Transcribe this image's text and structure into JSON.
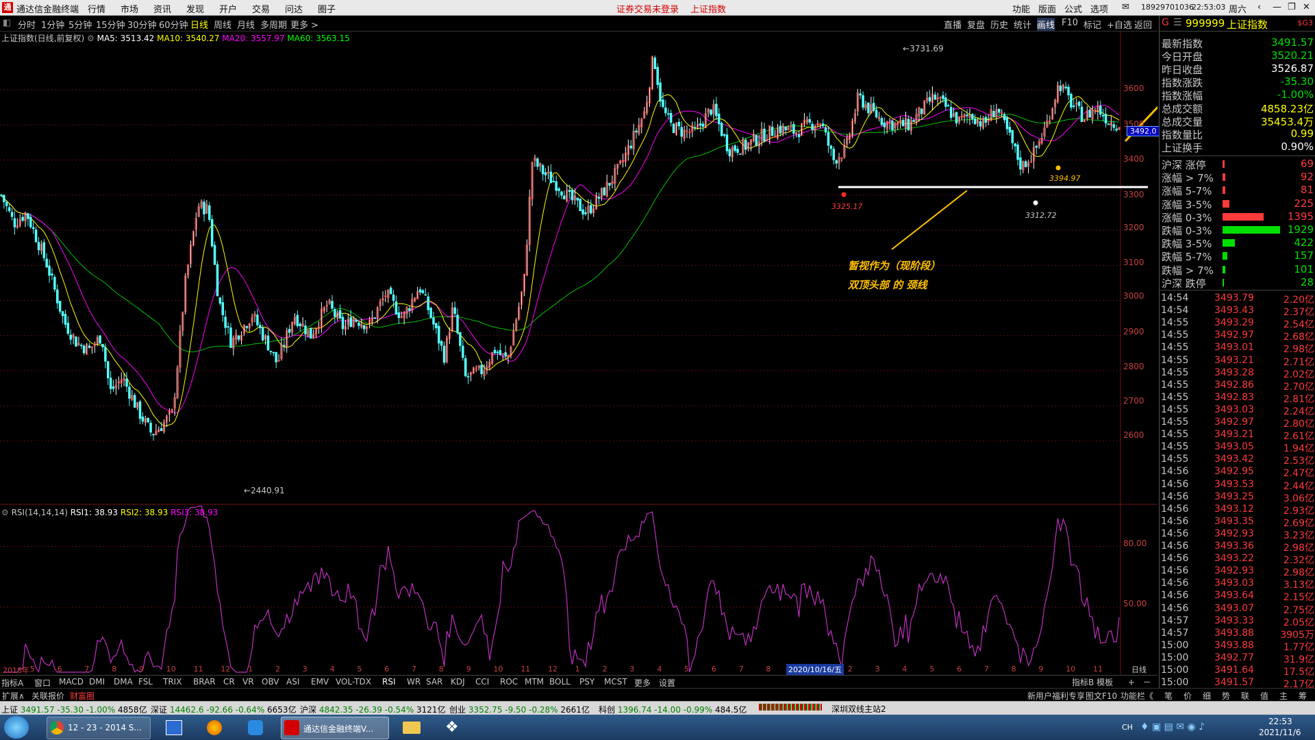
{
  "menubar": {
    "app_title": "通达信金融终端",
    "items": [
      "行情",
      "市场",
      "资讯",
      "发现",
      "开户",
      "交易",
      "问达",
      "圈子"
    ],
    "alert": "证券交易未登录",
    "alert_index": "上证指数",
    "right_items": [
      "功能",
      "版面",
      "公式",
      "选项"
    ],
    "account": "18929701036",
    "time": "22:53:03",
    "weekday": "周六"
  },
  "periodbar": {
    "periods": [
      "分时",
      "1分钟",
      "5分钟",
      "15分钟",
      "30分钟",
      "60分钟",
      "日线",
      "周线",
      "月线",
      "多周期",
      "更多 >"
    ],
    "selected": "日线",
    "tools": [
      "直播",
      "复盘",
      "历史",
      "统计",
      "画线",
      "F10",
      "标记",
      "+自选",
      "返回"
    ],
    "tool_selected": "画线"
  },
  "chart": {
    "title": "上证指数(日线,前复权)",
    "ma": [
      {
        "label": "MA5: 3513.42",
        "color": "#ffffff"
      },
      {
        "label": "MA10: 3540.27",
        "color": "#ffff00"
      },
      {
        "label": "MA20: 3557.97",
        "color": "#ff00ff"
      },
      {
        "label": "MA60: 3563.15",
        "color": "#00ff00"
      }
    ],
    "y_ticks": [
      "3600",
      "3500",
      "3400",
      "3300",
      "3200",
      "3100",
      "3000",
      "2900",
      "2800",
      "2700",
      "2600"
    ],
    "current_price_label": "3492.0",
    "annotations": {
      "high": "3731.69",
      "low": "2440.91",
      "point_a": "3325.17",
      "point_b": "3312.72",
      "point_c": "3394.97",
      "note_line1": "暂视作为（现阶段）",
      "note_line2": "双顶头部 的 颈线",
      "question": "?"
    },
    "x_ticks": [
      "2018年",
      "5",
      "6",
      "7",
      "8",
      "9",
      "10",
      "11",
      "12",
      "1",
      "2",
      "3",
      "4",
      "5",
      "6",
      "7",
      "8",
      "9",
      "10",
      "11",
      "12",
      "1",
      "2",
      "3",
      "4",
      "5",
      "6",
      "7",
      "8",
      "9",
      "1",
      "2",
      "3",
      "4",
      "5",
      "6",
      "7",
      "8",
      "9",
      "10",
      "11"
    ],
    "cursor_date": "2020/10/16/五",
    "period_label": "日线"
  },
  "rsi": {
    "title": "RSI(14,14,14)",
    "rsi1": "RSI1: 38.93",
    "rsi2": "RSI2: 38.93",
    "rsi3": "RSI3: 38.93",
    "y_ticks": [
      "80.00",
      "50.00"
    ]
  },
  "panel": {
    "code": "999999",
    "name": "上证指数",
    "tag": "$G3",
    "quotes": [
      {
        "k": "最新指数",
        "v": "3491.57",
        "c": "#00e000"
      },
      {
        "k": "今日开盘",
        "v": "3520.21",
        "c": "#00e000"
      },
      {
        "k": "昨日收盘",
        "v": "3526.87",
        "c": "#ffffff"
      },
      {
        "k": "指数涨跌",
        "v": "-35.30",
        "c": "#00e000"
      },
      {
        "k": "指数涨幅",
        "v": "-1.00%",
        "c": "#00e000"
      },
      {
        "k": "总成交额",
        "v": "4858.23亿",
        "c": "#ffff00"
      },
      {
        "k": "总成交量",
        "v": "35453.4万",
        "c": "#ffff00"
      },
      {
        "k": "指数量比",
        "v": "0.99",
        "c": "#ffff00"
      },
      {
        "k": "上证换手",
        "v": "0.90%",
        "c": "#ffffff"
      }
    ],
    "breadth": [
      {
        "k": "沪深 涨停",
        "v": "69",
        "c": "#ff3a3a",
        "bar": 0.04
      },
      {
        "k": "涨幅 > 7%",
        "v": "92",
        "c": "#ff3a3a",
        "bar": 0.05
      },
      {
        "k": "涨幅 5-7%",
        "v": "81",
        "c": "#ff3a3a",
        "bar": 0.05
      },
      {
        "k": "涨幅 3-5%",
        "v": "225",
        "c": "#ff3a3a",
        "bar": 0.12
      },
      {
        "k": "涨幅 0-3%",
        "v": "1395",
        "c": "#ff3a3a",
        "bar": 0.72
      },
      {
        "k": "跌幅 0-3%",
        "v": "1929",
        "c": "#00e000",
        "bar": 1.0
      },
      {
        "k": "跌幅 3-5%",
        "v": "422",
        "c": "#00e000",
        "bar": 0.22
      },
      {
        "k": "跌幅 5-7%",
        "v": "157",
        "c": "#00e000",
        "bar": 0.08
      },
      {
        "k": "跌幅 > 7%",
        "v": "101",
        "c": "#00e000",
        "bar": 0.05
      },
      {
        "k": "沪深 跌停",
        "v": "28",
        "c": "#00e000",
        "bar": 0.02
      }
    ],
    "ticks": [
      {
        "t": "14:54",
        "p": "3493.79",
        "q": "2.20亿"
      },
      {
        "t": "14:54",
        "p": "3493.43",
        "q": "2.37亿"
      },
      {
        "t": "14:55",
        "p": "3493.29",
        "q": "2.54亿"
      },
      {
        "t": "14:55",
        "p": "3492.97",
        "q": "2.68亿"
      },
      {
        "t": "14:55",
        "p": "3493.01",
        "q": "2.98亿"
      },
      {
        "t": "14:55",
        "p": "3493.21",
        "q": "2.71亿"
      },
      {
        "t": "14:55",
        "p": "3493.28",
        "q": "2.02亿"
      },
      {
        "t": "14:55",
        "p": "3492.86",
        "q": "2.70亿"
      },
      {
        "t": "14:55",
        "p": "3492.83",
        "q": "2.81亿"
      },
      {
        "t": "14:55",
        "p": "3493.03",
        "q": "2.24亿"
      },
      {
        "t": "14:55",
        "p": "3492.97",
        "q": "2.80亿"
      },
      {
        "t": "14:55",
        "p": "3493.21",
        "q": "2.61亿"
      },
      {
        "t": "14:55",
        "p": "3493.05",
        "q": "1.94亿"
      },
      {
        "t": "14:55",
        "p": "3493.42",
        "q": "2.53亿"
      },
      {
        "t": "14:56",
        "p": "3492.95",
        "q": "2.47亿"
      },
      {
        "t": "14:56",
        "p": "3493.53",
        "q": "2.44亿"
      },
      {
        "t": "14:56",
        "p": "3493.25",
        "q": "3.06亿"
      },
      {
        "t": "14:56",
        "p": "3493.12",
        "q": "2.93亿"
      },
      {
        "t": "14:56",
        "p": "3493.35",
        "q": "2.69亿"
      },
      {
        "t": "14:56",
        "p": "3492.93",
        "q": "3.23亿"
      },
      {
        "t": "14:56",
        "p": "3493.36",
        "q": "2.98亿"
      },
      {
        "t": "14:56",
        "p": "3493.22",
        "q": "2.32亿"
      },
      {
        "t": "14:56",
        "p": "3492.93",
        "q": "2.98亿"
      },
      {
        "t": "14:56",
        "p": "3493.03",
        "q": "3.13亿"
      },
      {
        "t": "14:56",
        "p": "3493.64",
        "q": "2.15亿"
      },
      {
        "t": "14:56",
        "p": "3493.07",
        "q": "2.75亿"
      },
      {
        "t": "14:57",
        "p": "3493.33",
        "q": "2.05亿"
      },
      {
        "t": "14:57",
        "p": "3493.88",
        "q": "3905万"
      },
      {
        "t": "15:00",
        "p": "3493.88",
        "q": "1.77亿"
      },
      {
        "t": "15:00",
        "p": "3492.77",
        "q": "31.9亿"
      },
      {
        "t": "15:00",
        "p": "3491.64",
        "q": "17.5亿"
      },
      {
        "t": "15:00",
        "p": "3491.57",
        "q": "2.17亿"
      }
    ],
    "bottom_tabs": [
      "笔",
      "价",
      "细",
      "势",
      "联",
      "值",
      "主",
      "筹"
    ]
  },
  "indicators": [
    "指标A",
    "窗口",
    "MACD",
    "DMI",
    "DMA",
    "FSL",
    "TRIX",
    "BRAR",
    "CR",
    "VR",
    "OBV",
    "ASI",
    "EMV",
    "VOL-TDX",
    "RSI",
    "WR",
    "SAR",
    "KDJ",
    "CCI",
    "ROC",
    "MTM",
    "BOLL",
    "PSY",
    "MCST",
    "更多",
    "设置"
  ],
  "indicators_right": [
    "指标B",
    "模板",
    "+",
    "－"
  ],
  "tabs": [
    "扩展∧",
    "关联报价",
    "财富圈"
  ],
  "tabs_right": [
    "新用户福利专享",
    "图文F10",
    "功能栏《"
  ],
  "ticker": [
    {
      "name": "上证",
      "val": "3491.57",
      "chg": "-35.30",
      "pct": "-1.00%",
      "amt": "4858亿"
    },
    {
      "name": "深证",
      "val": "14462.6",
      "chg": "-92.66",
      "pct": "-0.64%",
      "amt": "6653亿"
    },
    {
      "name": "沪深",
      "val": "4842.35",
      "chg": "-26.39",
      "pct": "-0.54%",
      "amt": "3121亿"
    },
    {
      "name": "创业",
      "val": "3352.75",
      "chg": "-9.50",
      "pct": "-0.28%",
      "amt": "2661亿"
    },
    {
      "name": "科创",
      "val": "1396.74",
      "chg": "-14.00",
      "pct": "-0.99%",
      "amt": "484.5亿"
    }
  ],
  "ticker_station": "深圳双线主站2",
  "taskbar": {
    "chrome_title": "12 - 23 - 2014 S...",
    "tdx_title": "通达信金融终端V...",
    "lang": "CH",
    "time": "22:53",
    "date": "2021/11/6"
  },
  "colors": {
    "up": "#ff3a3a",
    "down": "#00e000",
    "rsi": "#c030c0",
    "ma60": "#00c000",
    "ma20": "#ff00ff",
    "ma10": "#ffff00",
    "ma5": "#ffffff",
    "annotation": "#ffc000"
  }
}
